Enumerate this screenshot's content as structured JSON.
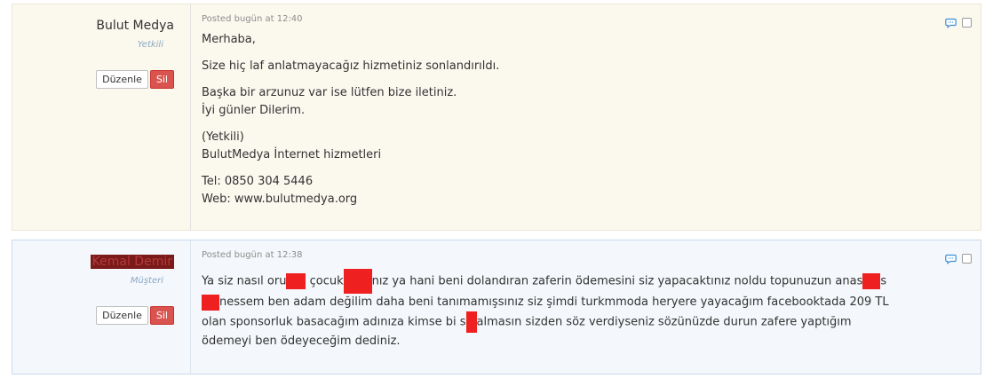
{
  "posts": {
    "staff": {
      "author_name": "Bulut Medya",
      "author_role": "Yetkili",
      "edit_label": "Düzenle",
      "delete_label": "Sil",
      "posted": "Posted bugün at 12:40",
      "lines": {
        "greeting": "Merhaba,",
        "p1": "Size hiç laf anlatmayacağız hizmetiniz sonlandırıldı.",
        "p2a": "Başka bir arzunuz var ise lütfen bize iletiniz.",
        "p2b": "İyi günler Dilerim.",
        "p3a": "(Yetkili)",
        "p3b": "BulutMedya İnternet hizmetleri",
        "p4a": "Tel: 0850 304 5446",
        "p4b": "Web: www.bulutmedya.org"
      }
    },
    "customer": {
      "author_name": "Kemal Demir",
      "author_role": "Müşteri",
      "edit_label": "Düzenle",
      "delete_label": "Sil",
      "posted": "Posted bugün at 12:38",
      "segments": {
        "s1": "Ya siz nasıl oru",
        "s2": " çocuk",
        "s3": "nız ya hani beni dolandıran zaferin ödemesini siz yapacaktınız noldu topunuzun anas",
        "s4": "s",
        "s5": "nessem ben adam değilim daha beni tanımamışsınız siz şimdi turkmmoda heryere yayacağım facebooktada 209 TL olan sponsorluk basacağım adınıza kimse bi s",
        "s6": "almasın sizden söz verdiyseniz sözünüzde durun zafere yaptığım ödemeyi ben ödeyeceğim dediniz."
      }
    }
  },
  "icons": {
    "quote": "speech-bubble-icon",
    "select": "checkbox"
  },
  "colors": {
    "staff_bg": "#fbf8ee",
    "customer_bg": "#f4f7fb",
    "delete_button": "#d9534f",
    "redaction": "#ee2020",
    "role_text": "#8aa7c4"
  }
}
